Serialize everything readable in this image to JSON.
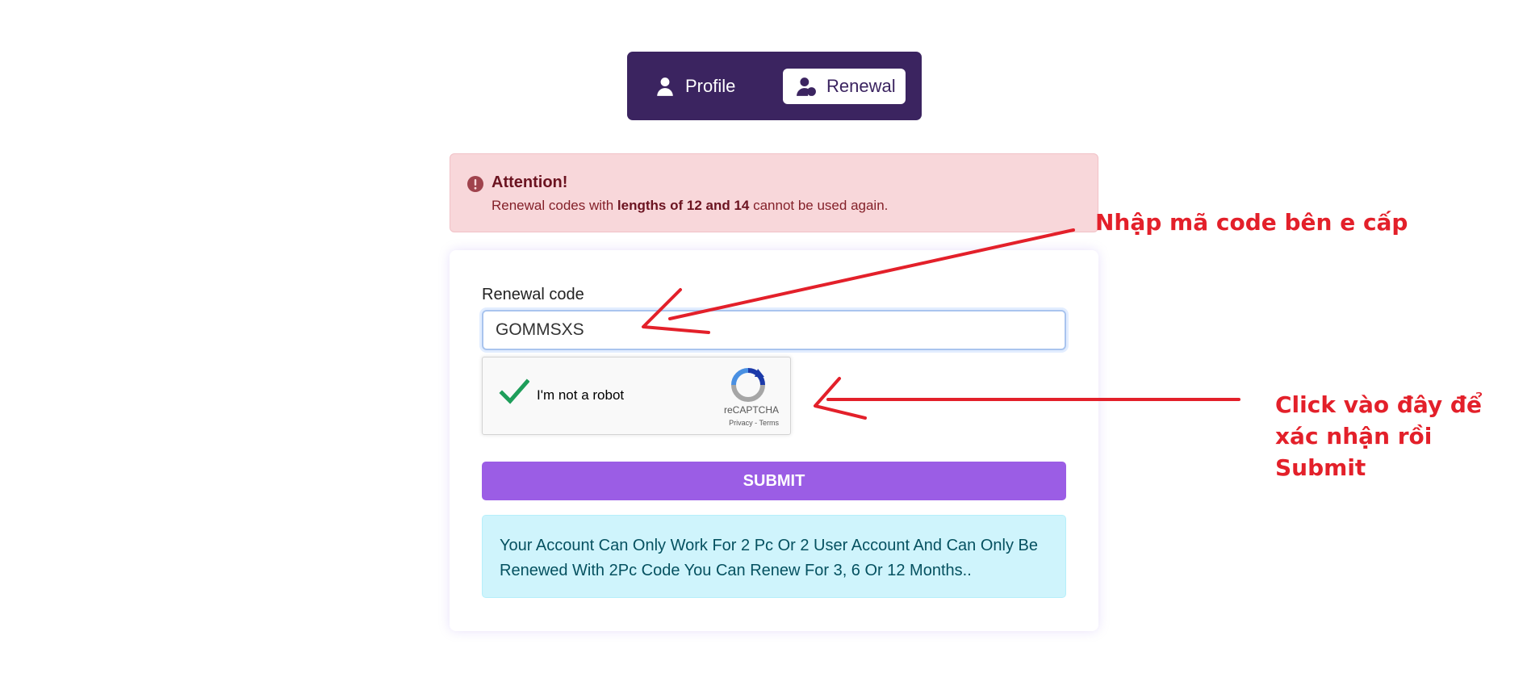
{
  "tabs": [
    {
      "label": "Profile",
      "icon": "user-icon",
      "active": false
    },
    {
      "label": "Renewal",
      "icon": "user-renew-icon",
      "active": true
    }
  ],
  "alert": {
    "title": "Attention!",
    "text_before": "Renewal codes with ",
    "text_bold": "lengths of 12 and 14",
    "text_after": " cannot be used again.",
    "icon": "exclamation-circle-icon"
  },
  "form": {
    "label": "Renewal code",
    "value": "GOMMSXS",
    "submit_label": "SUBMIT"
  },
  "recaptcha": {
    "label": "I'm not a robot",
    "brand": "reCAPTCHA",
    "privacy": "Privacy",
    "separator": " - ",
    "terms": "Terms",
    "checked": true
  },
  "info": {
    "text": "Your Account Can Only Work For 2 Pc Or 2 User Account And Can Only Be Renewed With 2Pc Code You Can Renew For 3, 6 Or 12 Months.."
  },
  "annotations": {
    "code_hint": "Nhập mã code bên e cấp",
    "captcha_hint": "Click vào đây để xác nhận rồi Submit"
  },
  "colors": {
    "tab_bar": "#3b2460",
    "submit": "#9b5de5",
    "alert_bg": "#f8d7da",
    "info_bg": "#cff4fc",
    "annotation": "#e3202a"
  }
}
